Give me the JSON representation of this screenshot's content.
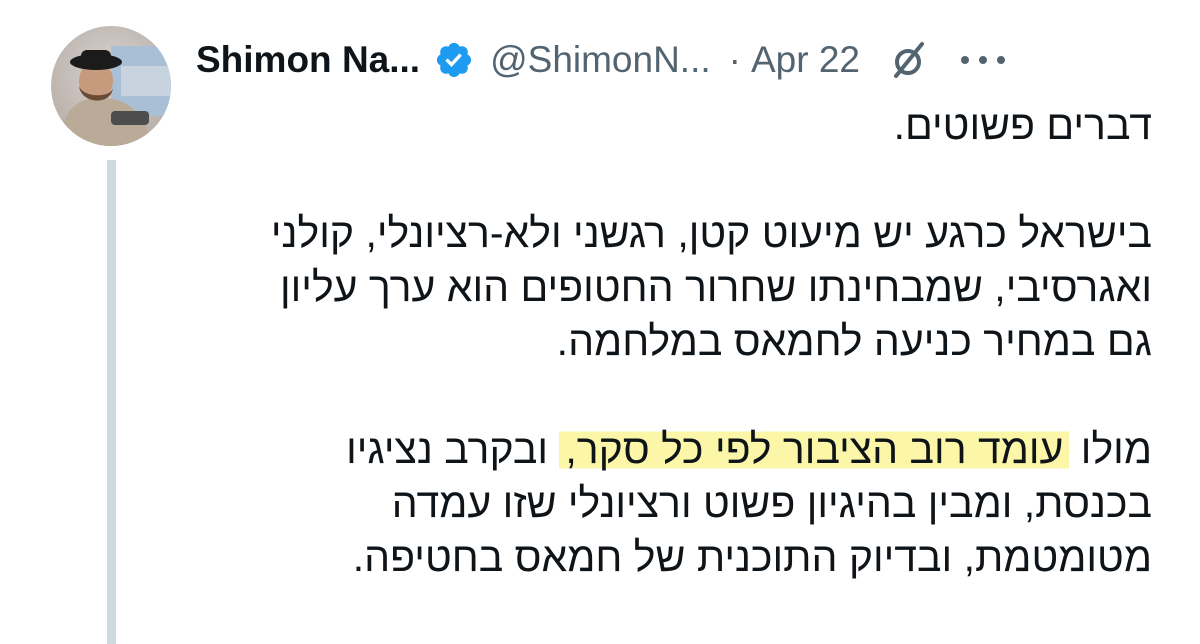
{
  "tweet": {
    "author_name": "Shimon Na...",
    "handle": "@ShimonN...",
    "separator": "·",
    "date": "Apr 22",
    "icons": {
      "avatar": "avatar",
      "verified": "verified-badge-icon",
      "grok": "grok-icon",
      "more": "more-options-icon"
    },
    "colors": {
      "verified_blue": "#1d9bf0",
      "secondary_text": "#536471",
      "highlight": "#fbf6a8",
      "thread_line": "#cfd9de"
    },
    "paragraphs": {
      "p1": "דברים פשוטים.",
      "p2_line1": "בישראל כרגע יש מיעוט קטן, רגשני ולא-רציונלי, קולני",
      "p2_line2": "ואגרסיבי,  שמבחינתו שחרור החטופים הוא ערך עליון",
      "p2_line3": "גם במחיר כניעה לחמאס במלחמה.",
      "p3_line1_pre": "מולו ",
      "p3_line1_highlight": "עומד רוב הציבור לפי כל סקר,",
      "p3_line1_post": " ובקרב נציגיו",
      "p3_line2": "בכנסת, ומבין בהיגיון פשוט ורציונלי שזו עמדה",
      "p3_line3": "מטומטמת, ובדיוק התוכנית של חמאס בחטיפה."
    }
  }
}
